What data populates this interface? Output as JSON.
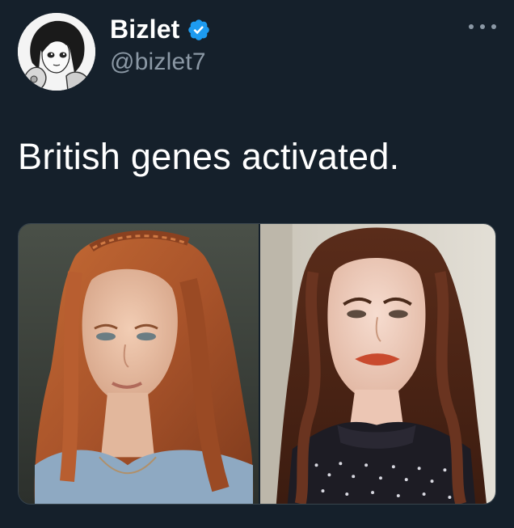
{
  "author": {
    "display_name": "Bizlet",
    "handle": "@bizlet7",
    "verified": true,
    "verified_color": "#1d9bf0"
  },
  "tweet": {
    "text": "British genes activated."
  },
  "icons": {
    "more": "more-options-icon",
    "verified": "verified-badge-icon"
  },
  "theme": {
    "background": "#15202b",
    "text_primary": "#ffffff",
    "text_secondary": "#8b98a5"
  }
}
